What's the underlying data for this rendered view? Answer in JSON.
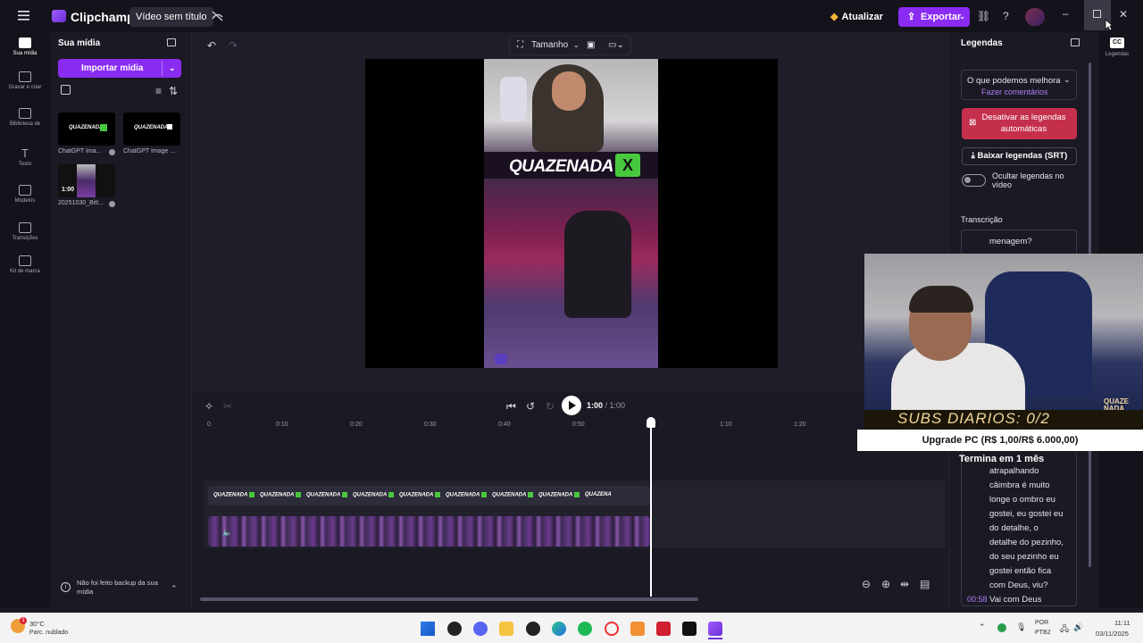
{
  "app": {
    "name": "Clipchamp",
    "project_title": "Vídeo sem título"
  },
  "topbar": {
    "update_label": "Atualizar",
    "export_label": "Exportar",
    "help": "?"
  },
  "rail": [
    {
      "label": "Sua mídia"
    },
    {
      "label": "Gravar e criar"
    },
    {
      "label": "Biblioteca de"
    },
    {
      "label": "Texto"
    },
    {
      "label": "Modelos"
    },
    {
      "label": "Transições"
    },
    {
      "label": "Kit de marca"
    }
  ],
  "media": {
    "title": "Sua mídia",
    "import_label": "Importar mídia",
    "items": [
      {
        "caption": "ChatGPT Ima...",
        "thumb_text": "QUAZENADA"
      },
      {
        "caption": "ChatGPT Image ...",
        "thumb_text": "QUAZENADA"
      },
      {
        "caption": "20251030_Bitt...",
        "duration": "1:00"
      }
    ],
    "backup_text": "Não foi feito backup da sua mídia"
  },
  "preview": {
    "size_label": "Tamanho",
    "overlay_text": "QUAZENADA",
    "overlay_x": "X"
  },
  "timeline": {
    "current": "1:00",
    "total": "/ 1:00",
    "ticks": [
      "0",
      "0:10",
      "0:20",
      "0:30",
      "0:40",
      "0:50",
      "1:00",
      "1:10",
      "1:20"
    ],
    "clip_labels": [
      "QUAZENADA",
      "QUAZENADA",
      "QUAZENADA",
      "QUAZENADA",
      "QUAZENADA",
      "QUAZENADA",
      "QUAZENADA",
      "QUAZENADA",
      "QUAZENA"
    ]
  },
  "captions_panel": {
    "title": "Legendas",
    "feedback_q": "O que podemos melhora",
    "feedback_link": "Fazer comentários",
    "disable_label": "Desativar as legendas automáticas",
    "download_label": "Baixar legendas (SRT)",
    "hide_label": "Ocultar legendas no vídeo",
    "transcription_title": "Transcrição",
    "top_line": "menagem?",
    "lines": [
      "atrapalhando",
      "câimbra é muito",
      "longe o ombro eu",
      "gostei, eu gostei eu",
      "do detalhe, o",
      "detalhe do pezinho,",
      "do seu pezinho eu",
      "gostei então fica",
      "com Deus, viu?"
    ],
    "last_time": "00:58",
    "last_text": "Vai com Deus"
  },
  "right_rail": {
    "label": "Legendas",
    "icon": "CC"
  },
  "overlay": {
    "subs_text": "SUBS DIARIOS: 0/2",
    "upgrade_text": "Upgrade PC (R$ 1,00/R$ 6.000,00)",
    "termina_text": "Termina em 1 mês",
    "logo_text": "QUAZE NADA"
  },
  "taskbar": {
    "weather_temp": "30°C",
    "weather_desc": "Parc. nublado",
    "lang": "POR",
    "layout": "PTB2",
    "time": "11:11",
    "date": "03/11/2025"
  }
}
